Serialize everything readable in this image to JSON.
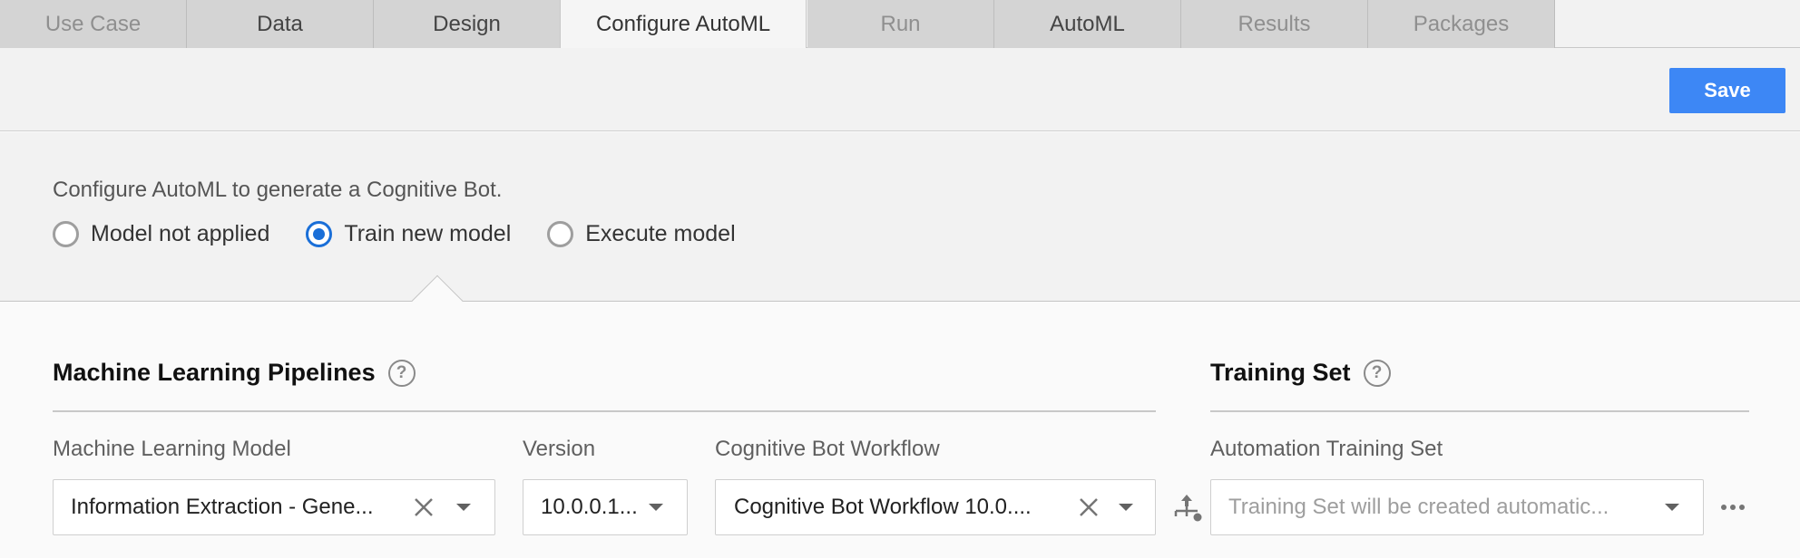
{
  "tabs": [
    {
      "label": "Use Case",
      "state": "disabled"
    },
    {
      "label": "Data",
      "state": "enabled"
    },
    {
      "label": "Design",
      "state": "enabled"
    },
    {
      "label": "Configure AutoML",
      "state": "active"
    },
    {
      "label": "Run",
      "state": "disabled"
    },
    {
      "label": "AutoML",
      "state": "enabled"
    },
    {
      "label": "Results",
      "state": "disabled"
    },
    {
      "label": "Packages",
      "state": "disabled"
    }
  ],
  "toolbar": {
    "save_label": "Save",
    "accent": "#3d87f5"
  },
  "mode": {
    "intro": "Configure AutoML to generate a Cognitive Bot.",
    "options": [
      {
        "label": "Model not applied",
        "checked": false
      },
      {
        "label": "Train new model",
        "checked": true
      },
      {
        "label": "Execute model",
        "checked": false
      }
    ],
    "radio_color": "#1a6fd8"
  },
  "pipelines": {
    "title": "Machine Learning Pipelines",
    "help_icon": "question-circle-icon",
    "model_label": "Machine Learning Model",
    "model_value": "Information Extraction - Gene...",
    "version_label": "Version",
    "version_value": "10.0.0.1...",
    "workflow_label": "Cognitive Bot Workflow",
    "workflow_value": "Cognitive Bot Workflow 10.0...."
  },
  "training": {
    "title": "Training Set",
    "help_icon": "question-circle-icon",
    "set_label": "Automation Training Set",
    "set_placeholder": "Training Set will be created automatic...",
    "workflow_icon": "workflow-icon",
    "more_icon": "more-horizontal-icon"
  }
}
